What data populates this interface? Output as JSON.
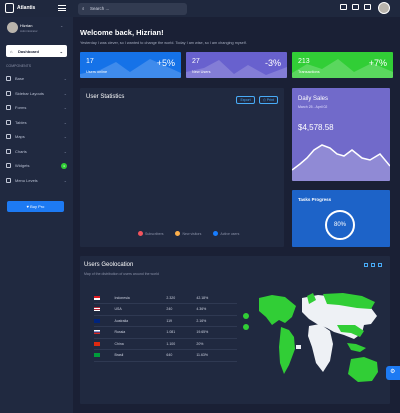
{
  "app": {
    "name": "Atlantis"
  },
  "search": {
    "placeholder": "Search ..."
  },
  "profile": {
    "name": "Hizrian",
    "role": "Administrator"
  },
  "sidebar": {
    "active": "Dashboard",
    "section_title": "COMPONENTS",
    "items": [
      {
        "label": "Base",
        "has_badge": false
      },
      {
        "label": "Sidebar Layouts",
        "has_badge": false
      },
      {
        "label": "Forms",
        "has_badge": false
      },
      {
        "label": "Tables",
        "has_badge": false
      },
      {
        "label": "Maps",
        "has_badge": false
      },
      {
        "label": "Charts",
        "has_badge": false
      },
      {
        "label": "Widgets",
        "has_badge": true,
        "badge": "4"
      },
      {
        "label": "Menu Levels",
        "has_badge": false
      }
    ],
    "buy_button": "Buy Pro"
  },
  "welcome": {
    "title": "Welcome back, Hizrian!",
    "subtitle": "Yesterday I was clever, so I wanted to change the world. Today I am wise, so I am changing myself."
  },
  "kpis": [
    {
      "value": "17",
      "label": "Users online",
      "percent": "+5%",
      "color": "#1572e8"
    },
    {
      "value": "27",
      "label": "New Users",
      "percent": "-3%",
      "color": "#6861ce"
    },
    {
      "value": "213",
      "label": "Transactions",
      "percent": "+7%",
      "color": "#31ce36"
    }
  ],
  "stats": {
    "title": "User Statistics",
    "export": "Export",
    "print": "Print",
    "legend": [
      "Subscribers",
      "New visitors",
      "Active users"
    ],
    "legend_colors": [
      "#f3545d",
      "#fdaf4b",
      "#177dff"
    ]
  },
  "daily_sales": {
    "title": "Daily Sales",
    "date": "March 25 - April 02",
    "amount": "$4,578.58"
  },
  "tasks": {
    "title": "Tasks Progress",
    "value": "80%"
  },
  "geo": {
    "title": "Users Geolocation",
    "subtitle": "Map of the distribution of users around the world",
    "rows": [
      {
        "country": "Indonesia",
        "users": "2.320",
        "percent": "42.18%"
      },
      {
        "country": "USA",
        "users": "240",
        "percent": "4.36%"
      },
      {
        "country": "Australia",
        "users": "119",
        "percent": "2.16%"
      },
      {
        "country": "Russia",
        "users": "1.081",
        "percent": "19.65%"
      },
      {
        "country": "China",
        "users": "1.100",
        "percent": "20%"
      },
      {
        "country": "Brasil",
        "users": "640",
        "percent": "11.63%"
      }
    ]
  }
}
